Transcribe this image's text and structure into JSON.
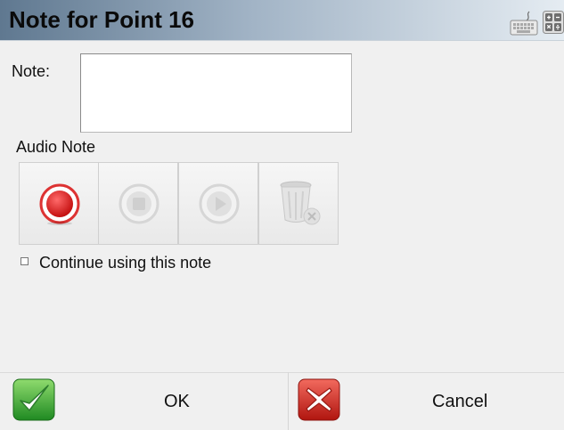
{
  "title": "Note for Point 16",
  "note_form": {
    "label": "Note:",
    "value": "",
    "audio_label": "Audio Note"
  },
  "audio_buttons": [
    "record",
    "stop",
    "play",
    "delete"
  ],
  "continue_checkbox": {
    "label": "Continue using this note",
    "checked": false
  },
  "buttons": {
    "ok": "OK",
    "cancel": "Cancel"
  },
  "icons": {
    "keyboard": "keyboard-icon",
    "calculator": "calculator-icon"
  },
  "colors": {
    "record_red": "#d01818",
    "ok_green": "#2c9a2c",
    "cancel_red": "#c21a1a"
  }
}
